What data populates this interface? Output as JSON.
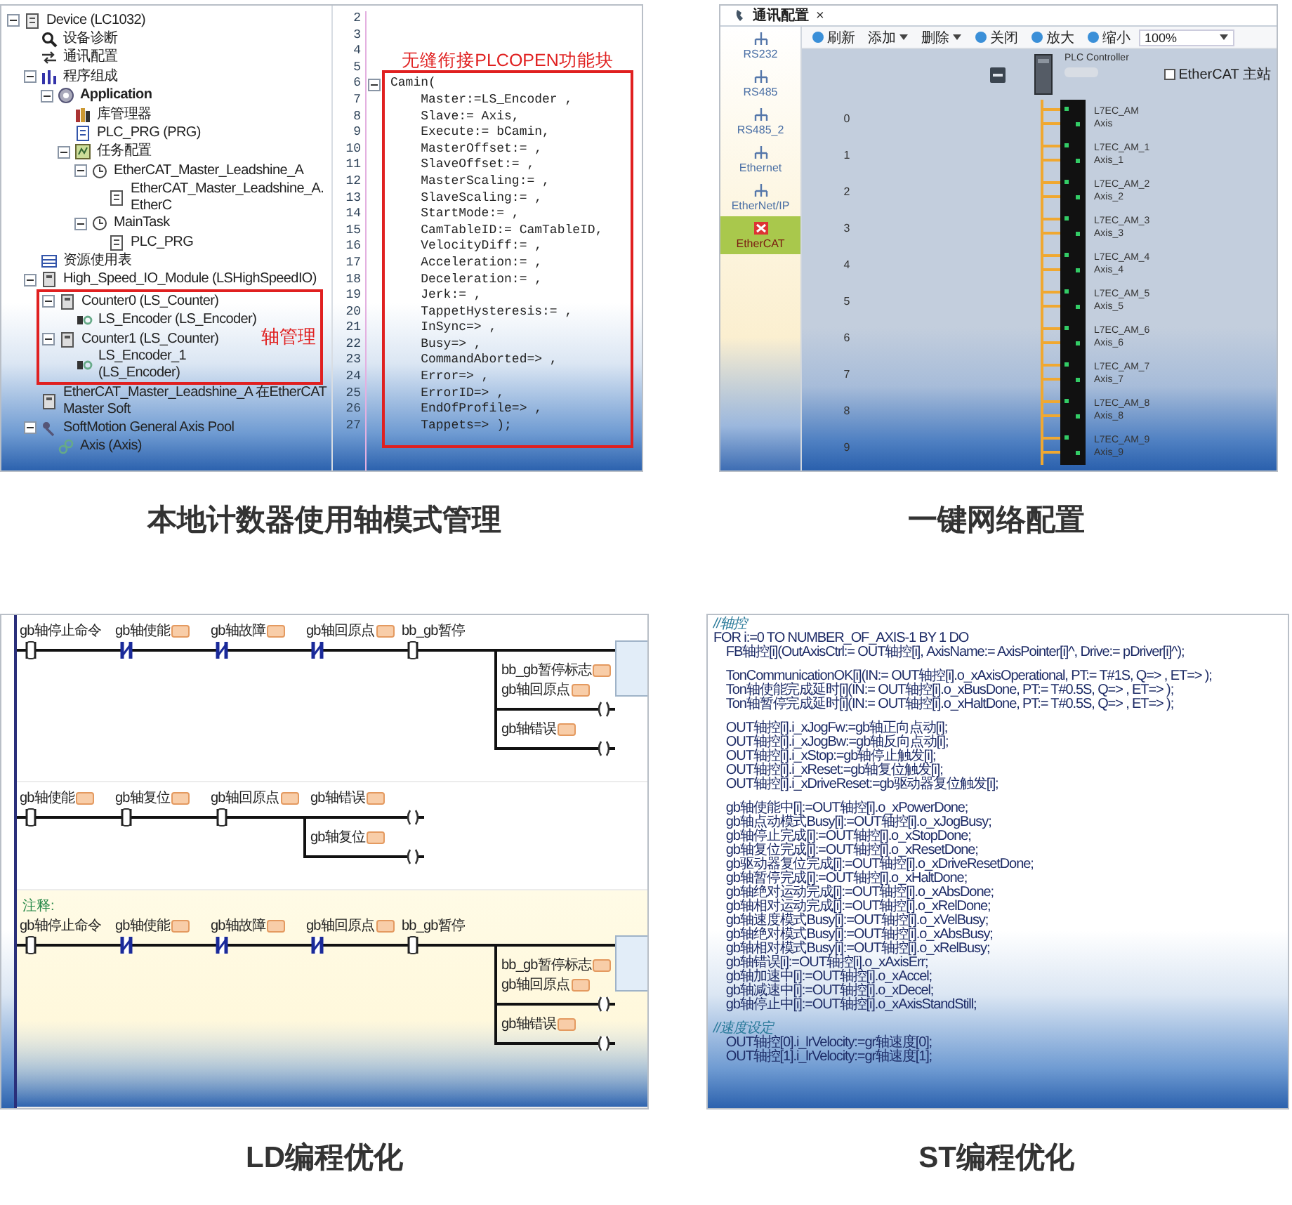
{
  "panels": [
    {
      "kind": "tree_code",
      "caption": "本地计数器使用轴模式管理",
      "tree": [
        {
          "kind": "device",
          "label": "Device (LC1032)",
          "expanded": true,
          "children": [
            {
              "kind": "diagnosis",
              "label": "设备诊断"
            },
            {
              "kind": "comm",
              "label": "通讯配置"
            },
            {
              "kind": "program",
              "label": "程序组成",
              "expanded": true,
              "children": [
                {
                  "kind": "application",
                  "label": "Application",
                  "bold": true,
                  "expanded": true,
                  "children": [
                    {
                      "kind": "library",
                      "label": "库管理器"
                    },
                    {
                      "kind": "pou",
                      "label": "PLC_PRG (PRG)"
                    },
                    {
                      "kind": "tasks",
                      "label": "任务配置",
                      "expanded": true,
                      "children": [
                        {
                          "kind": "task",
                          "label": "EtherCAT_Master_Leadshine_A",
                          "expanded": true,
                          "children": [
                            {
                              "kind": "call",
                              "label": "EtherCAT_Master_Leadshine_A.EtherC"
                            }
                          ]
                        },
                        {
                          "kind": "task",
                          "label": "MainTask",
                          "expanded": true,
                          "children": [
                            {
                              "kind": "call",
                              "label": "PLC_PRG"
                            }
                          ]
                        }
                      ]
                    }
                  ]
                }
              ]
            },
            {
              "kind": "table",
              "label": "资源使用表"
            },
            {
              "kind": "module",
              "label": "High_Speed_IO_Module (LSHighSpeedIO)",
              "expanded": true,
              "callout": "轴管理",
              "children": [
                {
                  "kind": "module",
                  "label": "Counter0 (LS_Counter)",
                  "expanded": true,
                  "children": [
                    {
                      "kind": "encoder",
                      "label": "LS_Encoder (LS_Encoder)"
                    }
                  ]
                },
                {
                  "kind": "module",
                  "label": "Counter1 (LS_Counter)",
                  "expanded": true,
                  "children": [
                    {
                      "kind": "encoder",
                      "label": "LS_Encoder_1 (LS_Encoder)"
                    }
                  ]
                }
              ]
            },
            {
              "kind": "module",
              "label": "EtherCAT_Master_Leadshine_A 在EtherCAT Master Soft"
            },
            {
              "kind": "axis_pool",
              "label": "SoftMotion General Axis Pool",
              "expanded": true,
              "children": [
                {
                  "kind": "axis",
                  "label": "Axis (Axis)"
                }
              ]
            }
          ]
        }
      ],
      "code_callout": "无缝衔接PLCOPEN功能块",
      "code_lines": [
        {
          "number": "2"
        },
        {
          "number": "3"
        },
        {
          "number": "4"
        },
        {
          "number": "5"
        },
        {
          "number": "6",
          "text": "Camin(",
          "expanded": true
        },
        {
          "number": "7",
          "text": "    Master:=LS_Encoder ,"
        },
        {
          "number": "8",
          "text": "    Slave:= Axis,"
        },
        {
          "number": "9",
          "text": "    Execute:= bCamin,"
        },
        {
          "number": "10",
          "text": "    MasterOffset:= ,"
        },
        {
          "number": "11",
          "text": "    SlaveOffset:= ,"
        },
        {
          "number": "12",
          "text": "    MasterScaling:= ,"
        },
        {
          "number": "13",
          "text": "    SlaveScaling:= ,"
        },
        {
          "number": "14",
          "text": "    StartMode:= ,"
        },
        {
          "number": "15",
          "text": "    CamTableID:= CamTableID,"
        },
        {
          "number": "16",
          "text": "    VelocityDiff:= ,"
        },
        {
          "number": "17",
          "text": "    Acceleration:= ,"
        },
        {
          "number": "18",
          "text": "    Deceleration:= ,"
        },
        {
          "number": "19",
          "text": "    Jerk:= ,"
        },
        {
          "number": "20",
          "text": "    TappetHysteresis:= ,"
        },
        {
          "number": "21",
          "text": "    InSync=> ,"
        },
        {
          "number": "22",
          "text": "    Busy=> ,"
        },
        {
          "number": "23",
          "text": "    CommandAborted=> ,"
        },
        {
          "number": "24",
          "text": "    Error=> ,"
        },
        {
          "number": "25",
          "text": "    ErrorID=> ,"
        },
        {
          "number": "26",
          "text": "    EndOfProfile=> ,"
        },
        {
          "number": "27",
          "text": "    Tappets=> );"
        }
      ]
    },
    {
      "kind": "network",
      "caption": "一键网络配置",
      "tab": {
        "label": "通讯配置",
        "close": "×"
      },
      "sidebar": [
        {
          "label": "RS232",
          "selected": false
        },
        {
          "label": "RS485",
          "selected": false
        },
        {
          "label": "RS485_2",
          "selected": false
        },
        {
          "label": "Ethernet",
          "selected": false
        },
        {
          "label": "EtherNet/IP",
          "selected": false
        },
        {
          "label": "EtherCAT",
          "selected": true
        }
      ],
      "toolbar": [
        {
          "kind": "button",
          "label": "刷新"
        },
        {
          "kind": "menu",
          "label": "添加"
        },
        {
          "kind": "menu",
          "label": "删除"
        },
        {
          "kind": "button",
          "label": "关闭"
        },
        {
          "kind": "button",
          "label": "放大"
        },
        {
          "kind": "button",
          "label": "缩小"
        },
        {
          "kind": "select",
          "label": "100%"
        }
      ],
      "master": {
        "label": "PLC Controller",
        "checkbox": {
          "label": "EtherCAT 主站",
          "checked": false
        }
      },
      "slaves": [
        {
          "index": "0",
          "name": "L7EC_AM",
          "axis": "Axis"
        },
        {
          "index": "1",
          "name": "L7EC_AM_1",
          "axis": "Axis_1"
        },
        {
          "index": "2",
          "name": "L7EC_AM_2",
          "axis": "Axis_2"
        },
        {
          "index": "3",
          "name": "L7EC_AM_3",
          "axis": "Axis_3"
        },
        {
          "index": "4",
          "name": "L7EC_AM_4",
          "axis": "Axis_4"
        },
        {
          "index": "5",
          "name": "L7EC_AM_5",
          "axis": "Axis_5"
        },
        {
          "index": "6",
          "name": "L7EC_AM_6",
          "axis": "Axis_6"
        },
        {
          "index": "7",
          "name": "L7EC_AM_7",
          "axis": "Axis_7"
        },
        {
          "index": "8",
          "name": "L7EC_AM_8",
          "axis": "Axis_8"
        },
        {
          "index": "9",
          "name": "L7EC_AM_9",
          "axis": "Axis_9"
        }
      ]
    },
    {
      "kind": "ladder",
      "caption": "LD编程优化",
      "rungs": [
        {
          "selected": false,
          "block": true,
          "contacts": [
            {
              "kind": "open",
              "label": "gb轴停止命令",
              "value_field": false
            },
            {
              "kind": "closed",
              "label": "gb轴使能",
              "value_field": true
            },
            {
              "kind": "closed",
              "label": "gb轴故障",
              "value_field": true
            },
            {
              "kind": "closed",
              "label": "gb轴回原点",
              "value_field": true
            },
            {
              "kind": "open",
              "label": "bb_gb暂停",
              "value_field": false
            }
          ],
          "outputs": [
            {
              "kind": "block_input",
              "label": "bb_gb暂停标志",
              "value_field": true
            },
            {
              "kind": "coil",
              "label": "gb轴回原点",
              "value_field": true
            },
            {
              "kind": "coil",
              "label": "gb轴错误",
              "value_field": true
            }
          ]
        },
        {
          "selected": false,
          "block": false,
          "contacts": [
            {
              "kind": "open",
              "label": "gb轴使能",
              "value_field": true
            },
            {
              "kind": "open",
              "label": "gb轴复位",
              "value_field": true
            },
            {
              "kind": "open",
              "label": "gb轴回原点",
              "value_field": true
            }
          ],
          "outputs": [
            {
              "kind": "coil",
              "label": "gb轴错误",
              "value_field": true
            },
            {
              "kind": "coil",
              "label": "gb轴复位",
              "value_field": true
            }
          ]
        },
        {
          "selected": true,
          "block": true,
          "comment": "注释:",
          "contacts": [
            {
              "kind": "open",
              "label": "gb轴停止命令",
              "value_field": false
            },
            {
              "kind": "closed",
              "label": "gb轴使能",
              "value_field": true
            },
            {
              "kind": "closed",
              "label": "gb轴故障",
              "value_field": true
            },
            {
              "kind": "closed",
              "label": "gb轴回原点",
              "value_field": true
            },
            {
              "kind": "open",
              "label": "bb_gb暂停",
              "value_field": false
            }
          ],
          "outputs": [
            {
              "kind": "block_input",
              "label": "bb_gb暂停标志",
              "value_field": true
            },
            {
              "kind": "coil",
              "label": "gb轴回原点",
              "value_field": true
            },
            {
              "kind": "coil",
              "label": "gb轴错误",
              "value_field": true
            }
          ]
        }
      ]
    },
    {
      "kind": "st_code",
      "caption": "ST编程优化",
      "lines": [
        {
          "kind": "comment",
          "text": "//轴控"
        },
        {
          "kind": "code",
          "text": "FOR i:=0 TO NUMBER_OF_AXIS-1 BY 1 DO"
        },
        {
          "kind": "code",
          "text": "    FB轴控[i](OutAxisCtrl:= OUT轴控[i], AxisName:= AxisPointer[i]^, Drive:= pDriver[i]^);"
        },
        {
          "kind": "blank"
        },
        {
          "kind": "code",
          "text": "    TonCommunicationOK[i](IN:= OUT轴控[i].o_xAxisOperational, PT:= T#1S, Q=> , ET=> );"
        },
        {
          "kind": "code",
          "text": "    Ton轴使能完成延时[i](IN:= OUT轴控[i].o_xBusDone, PT:= T#0.5S, Q=> , ET=> );"
        },
        {
          "kind": "code",
          "text": "    Ton轴暂停完成延时[i](IN:= OUT轴控[i].o_xHaltDone, PT:= T#0.5S, Q=> , ET=> );"
        },
        {
          "kind": "blank"
        },
        {
          "kind": "code",
          "text": "    OUT轴控[i].i_xJogFw:=gb轴正向点动[i];"
        },
        {
          "kind": "code",
          "text": "    OUT轴控[i].i_xJogBw:=gb轴反向点动[i];"
        },
        {
          "kind": "code",
          "text": "    OUT轴控[i].i_xStop:=gb轴停止触发[i];"
        },
        {
          "kind": "code",
          "text": "    OUT轴控[i].i_xReset:=gb轴复位触发[i];"
        },
        {
          "kind": "code",
          "text": "    OUT轴控[i].i_xDriveReset:=gb驱动器复位触发[i];"
        },
        {
          "kind": "blank"
        },
        {
          "kind": "code",
          "text": "    gb轴使能中[i]:=OUT轴控[i].o_xPowerDone;"
        },
        {
          "kind": "code",
          "text": "    gb轴点动模式Busy[i]:=OUT轴控[i].o_xJogBusy;"
        },
        {
          "kind": "code",
          "text": "    gb轴停止完成[i]:=OUT轴控[i].o_xStopDone;"
        },
        {
          "kind": "code",
          "text": "    gb轴复位完成[i]:=OUT轴控[i].o_xResetDone;"
        },
        {
          "kind": "code",
          "text": "    gb驱动器复位完成[i]:=OUT轴控[i].o_xDriveResetDone;"
        },
        {
          "kind": "code",
          "text": "    gb轴暂停完成[i]:=OUT轴控[i].o_xHaltDone;"
        },
        {
          "kind": "code",
          "text": "    gb轴绝对运动完成[i]:=OUT轴控[i].o_xAbsDone;"
        },
        {
          "kind": "code",
          "text": "    gb轴相对运动完成[i]:=OUT轴控[i].o_xRelDone;"
        },
        {
          "kind": "code",
          "text": "    gb轴速度模式Busy[i]:=OUT轴控[i].o_xVelBusy;"
        },
        {
          "kind": "code",
          "text": "    gb轴绝对模式Busy[i]:=OUT轴控[i].o_xAbsBusy;"
        },
        {
          "kind": "code",
          "text": "    gb轴相对模式Busy[i]:=OUT轴控[i].o_xRelBusy;"
        },
        {
          "kind": "code",
          "text": "    gb轴错误[i]:=OUT轴控[i].o_xAxisErr;"
        },
        {
          "kind": "code",
          "text": "    gb轴加速中[i]:=OUT轴控[i].o_xAccel;"
        },
        {
          "kind": "code",
          "text": "    gb轴减速中[i]:=OUT轴控[i].o_xDecel;"
        },
        {
          "kind": "code",
          "text": "    gb轴停止中[i]:=OUT轴控[i].o_xAxisStandStill;"
        },
        {
          "kind": "blank"
        },
        {
          "kind": "comment",
          "text": "//速度设定"
        },
        {
          "kind": "code",
          "text": "    OUT轴控[0].i_lrVelocity:=gr轴速度[0];"
        },
        {
          "kind": "code",
          "text": "    OUT轴控[1].i_lrVelocity:=gr轴速度[1];"
        }
      ]
    }
  ]
}
